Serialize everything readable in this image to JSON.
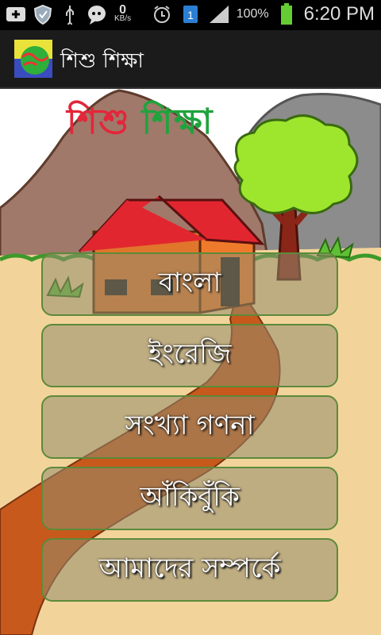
{
  "status_bar": {
    "net_speed_value": "0",
    "net_speed_unit": "KB/s",
    "signal_badge": "1",
    "battery_percent": "100%",
    "time": "6:20 PM",
    "icons": [
      "add-icon",
      "shield-icon",
      "usb-icon",
      "chat-icon",
      "alarm-icon",
      "sim-icon",
      "signal-icon",
      "battery-icon"
    ]
  },
  "action_bar": {
    "title": "শিশু শিক্ষা",
    "icon": "app-logo-icon"
  },
  "scene": {
    "title_word1": "শিশু",
    "title_word2": "শিক্ষা"
  },
  "menu": [
    {
      "label": "বাংলা"
    },
    {
      "label": "ইংরেজি"
    },
    {
      "label": "সংখ্যা গণনা"
    },
    {
      "label": "আঁকিবুঁকি"
    },
    {
      "label": "আমাদের সম্পর্কে"
    }
  ],
  "colors": {
    "sky": "#ffffff",
    "mountain": "#a0796a",
    "ground": "#f2d49b",
    "path": "#c7591c",
    "roof": "#e2262f",
    "house": "#f07a2c",
    "tree": "#9ee62d",
    "button_border": "#5c8a3a"
  }
}
